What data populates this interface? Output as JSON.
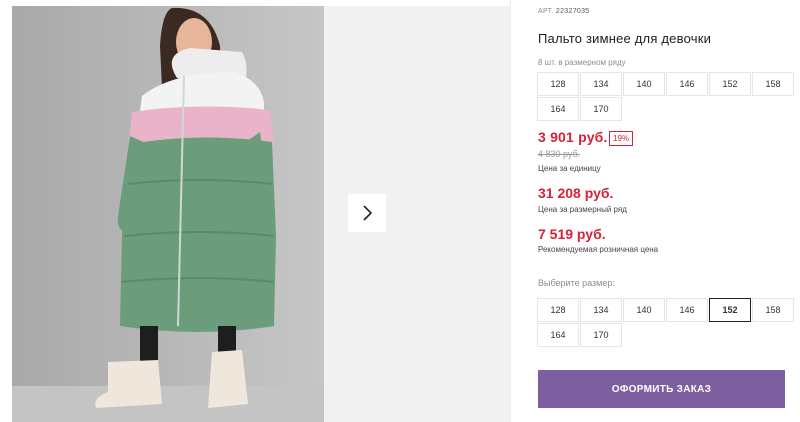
{
  "product": {
    "sku_label": "АРТ.",
    "sku": "22327035",
    "title": "Пальто зимнее для девочки",
    "image_alt": "photo-of-girl-in-long-green-puffer-coat",
    "pack_info": "8 шт. в размерном ряду",
    "pack_sizes": [
      "128",
      "134",
      "140",
      "146",
      "152",
      "158",
      "164",
      "170"
    ]
  },
  "pricing": {
    "unit_price": "3 901 руб.",
    "discount": "19%",
    "old_price": "4 830 руб.",
    "unit_label": "Цена за единицу",
    "pack_price": "31 208 руб.",
    "pack_label": "Цена за размерный ряд",
    "retail_price": "7 519 руб.",
    "retail_label": "Рекомендуемая розничная цена"
  },
  "size_select": {
    "label": "Выберите размер:",
    "sizes": [
      "128",
      "134",
      "140",
      "146",
      "152",
      "158",
      "164",
      "170"
    ],
    "selected": "152"
  },
  "actions": {
    "order_label": "ОФОРМИТЬ ЗАКАЗ",
    "next_icon": "chevron-right-icon"
  },
  "colors": {
    "price": "#d6213a",
    "button": "#7d5fa0",
    "coat_green": "#6b9c7c",
    "coat_pink": "#e9b4c9"
  }
}
